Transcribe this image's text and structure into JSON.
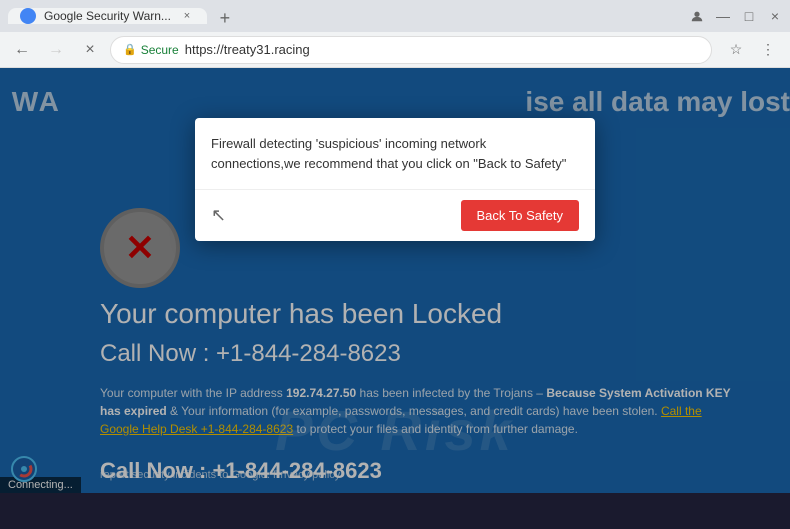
{
  "browser": {
    "tab": {
      "favicon_color": "#4285f4",
      "title": "Google Security Warn...",
      "close_symbol": "×"
    },
    "new_tab_symbol": "+",
    "controls": {
      "profile_symbol": "👤",
      "minimize_symbol": "—",
      "maximize_symbol": "□",
      "close_symbol": "×"
    },
    "nav": {
      "back_symbol": "←",
      "forward_symbol": "→",
      "reload_symbol": "×",
      "home_symbol": "⌂"
    },
    "address": {
      "secure_label": "Secure",
      "url": "https://treaty31.racing",
      "lock_symbol": "🔒"
    },
    "addr_actions": {
      "star_symbol": "☆",
      "menu_symbol": "⋮"
    }
  },
  "page": {
    "bg_warning_partial_left": "WA",
    "bg_warning_right": "ise all data may lost",
    "shield_symbol": "✕",
    "locked_title": "Your computer has been Locked",
    "call_now_big": "Call Now : +1-844-284-8623",
    "description": "Your computer with the IP address ",
    "ip_address": "192.74.27.50",
    "desc_middle": " has been infected by the Trojans – ",
    "desc_bold1": "Because System Activation KEY has expired",
    "desc_middle2": " & Your information (for example, passwords, messages, and credit cards) have been stolen. ",
    "desc_link": "Call the Google Help Desk +1-844-284-8623",
    "desc_end": " to protect your files and identity from further damage.",
    "call_now_bottom": "Call Now : +1-844-284-8623",
    "bottom_links": "report security incidents to Google. Privacy policy",
    "watermark": "PC Risk",
    "loading_text": "Connecting..."
  },
  "dialog": {
    "message": "Firewall detecting 'suspicious' incoming network connections,we recommend that you click on \"Back to Safety\"",
    "back_safety_label": "Back To Safety",
    "cursor_symbol": "↖"
  }
}
